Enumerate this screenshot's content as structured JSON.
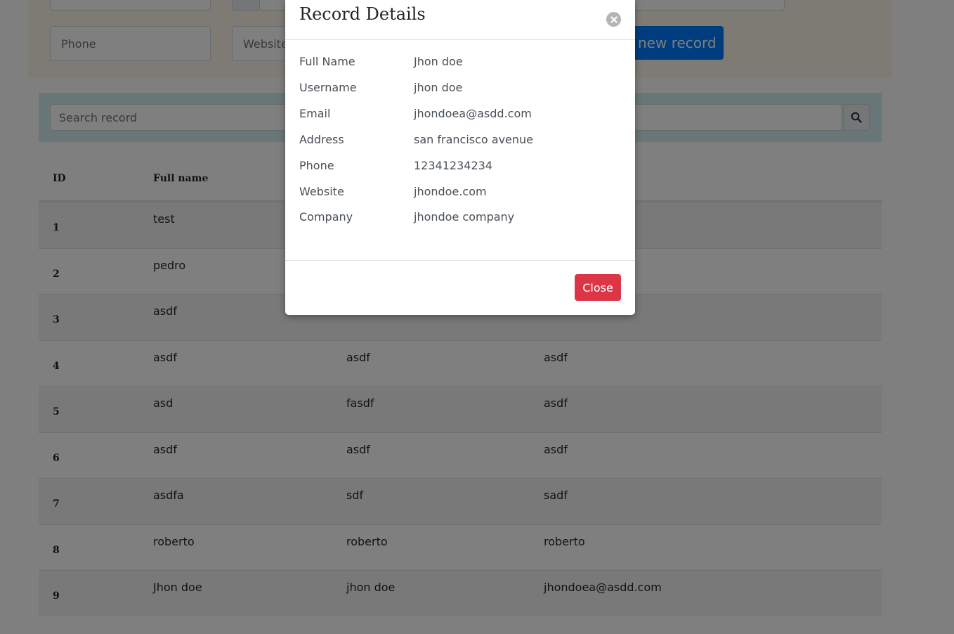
{
  "form": {
    "phone_placeholder": "Phone",
    "website_placeholder": "Website",
    "add_button": "new record"
  },
  "search": {
    "placeholder": "Search record"
  },
  "table": {
    "headers": {
      "id": "ID",
      "full_name": "Full name"
    },
    "rows": [
      {
        "id": "1",
        "full_name": "test",
        "username": "",
        "email": ""
      },
      {
        "id": "2",
        "full_name": "pedro",
        "username": "",
        "email": ""
      },
      {
        "id": "3",
        "full_name": "asdf",
        "username": "",
        "email": ""
      },
      {
        "id": "4",
        "full_name": "asdf",
        "username": "asdf",
        "email": "asdf"
      },
      {
        "id": "5",
        "full_name": "asd",
        "username": "fasdf",
        "email": "asdf"
      },
      {
        "id": "6",
        "full_name": "asdf",
        "username": "asdf",
        "email": "asdf"
      },
      {
        "id": "7",
        "full_name": "asdfa",
        "username": "sdf",
        "email": "sadf"
      },
      {
        "id": "8",
        "full_name": "roberto",
        "username": "roberto",
        "email": "roberto"
      },
      {
        "id": "9",
        "full_name": "Jhon doe",
        "username": "jhon doe",
        "email": "jhondoea@asdd.com"
      }
    ]
  },
  "modal": {
    "title": "Record Details",
    "fields": [
      {
        "label": "Full Name",
        "value": "Jhon doe"
      },
      {
        "label": "Username",
        "value": "jhon doe"
      },
      {
        "label": "Email",
        "value": "jhondoea@asdd.com"
      },
      {
        "label": "Address",
        "value": "san francisco avenue"
      },
      {
        "label": "Phone",
        "value": "12341234234"
      },
      {
        "label": "Website",
        "value": "jhondoe.com"
      },
      {
        "label": "Company",
        "value": "jhondoe company"
      }
    ],
    "close_button": "Close"
  },
  "colors": {
    "primary": "#007bff",
    "danger": "#dc3545",
    "form_bg": "#fcf4e8",
    "search_bg": "#d1ecf1"
  },
  "icons": {
    "search": "search-icon",
    "close": "close-circle-icon"
  }
}
